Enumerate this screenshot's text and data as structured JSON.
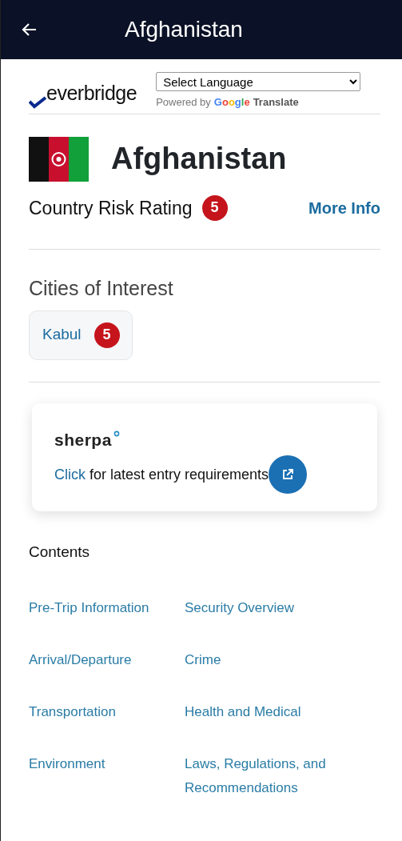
{
  "header": {
    "title": "Afghanistan"
  },
  "brand": {
    "logo": "everbridge",
    "language_select": {
      "value": "Select Language"
    },
    "powered_by": "Powered by",
    "google": "Google",
    "translate": "Translate"
  },
  "country": {
    "name": "Afghanistan",
    "risk_label": "Country Risk Rating",
    "risk_rating": "5",
    "more_info": "More Info"
  },
  "cities": {
    "heading": "Cities of Interest",
    "items": [
      {
        "name": "Kabul",
        "rating": "5"
      }
    ]
  },
  "sherpa": {
    "logo": "sherpa",
    "link": "Click",
    "text": "for latest entry requirements"
  },
  "contents": {
    "heading": "Contents",
    "links": [
      "Pre-Trip Information",
      "Security Overview",
      "Arrival/Departure",
      "Crime",
      "Transportation",
      "Health and Medical",
      "Environment",
      "Laws, Regulations, and Recommendations"
    ]
  }
}
